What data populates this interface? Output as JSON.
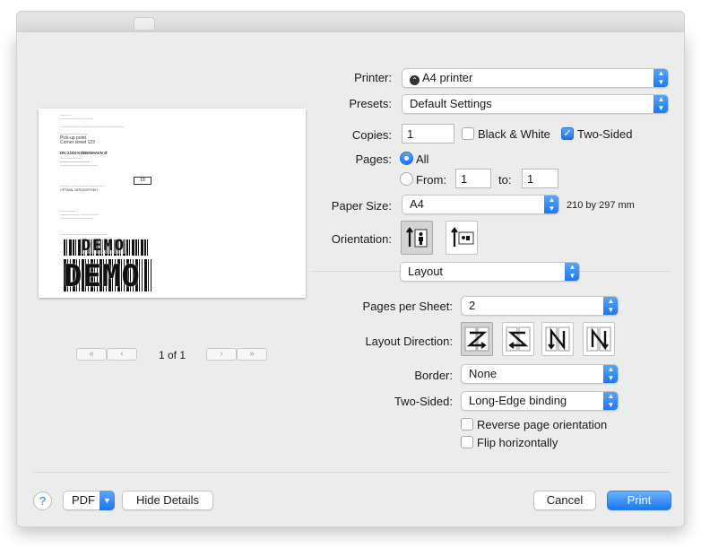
{
  "printer": {
    "label": "Printer:",
    "value": "A4 printer"
  },
  "presets": {
    "label": "Presets:",
    "value": "Default Settings"
  },
  "copies": {
    "label": "Copies:",
    "value": "1",
    "black_white": "Black & White",
    "two_sided": "Two-Sided",
    "two_sided_checked": true,
    "black_white_checked": false
  },
  "pages": {
    "label": "Pages:",
    "all": "All",
    "from": "From:",
    "from_value": "1",
    "to": "to:",
    "to_value": "1"
  },
  "paper_size": {
    "label": "Paper Size:",
    "value": "A4",
    "dimensions": "210 by 297 mm"
  },
  "orientation": {
    "label": "Orientation:"
  },
  "section": {
    "value": "Layout"
  },
  "pages_per_sheet": {
    "label": "Pages per Sheet:",
    "value": "2"
  },
  "layout_direction": {
    "label": "Layout Direction:",
    "options": [
      "Z",
      "S",
      "N-reversed",
      "N"
    ]
  },
  "border": {
    "label": "Border:",
    "value": "None"
  },
  "two_sided_binding": {
    "label": "Two-Sided:",
    "value": "Long-Edge binding"
  },
  "reverse_orientation": {
    "label": "Reverse page orientation",
    "checked": false
  },
  "flip_horizontally": {
    "label": "Flip horizontally",
    "checked": false
  },
  "preview": {
    "page_indicator": "1 of 1",
    "address_name": "Pick-up point",
    "address_street": "Corner street 123",
    "address_city": "DK-2100 KØBENHAVN Ø",
    "service": "OPTIMAL SERVICEPOINT",
    "barcode_top_text": "DEMO",
    "barcode_bottom_text": "DEMO",
    "box_number": "19"
  },
  "footer": {
    "help": "?",
    "pdf": "PDF",
    "hide_details": "Hide Details",
    "cancel": "Cancel",
    "print": "Print"
  },
  "colors": {
    "accent": "#1b78f2",
    "sheet_bg": "#ececec"
  }
}
